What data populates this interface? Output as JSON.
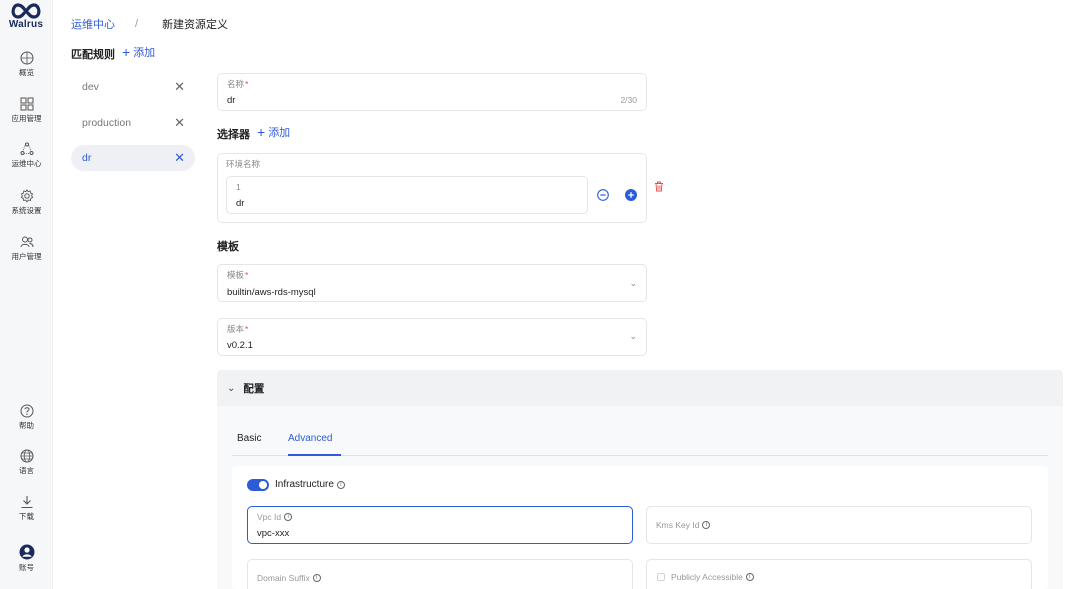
{
  "app": {
    "logo_text": "Walrus"
  },
  "sidebar": {
    "items": [
      {
        "label": "概览",
        "icon": "overview-icon"
      },
      {
        "label": "应用管理",
        "icon": "apps-grid-icon"
      },
      {
        "label": "运维中心",
        "icon": "ops-center-icon"
      },
      {
        "label": "系统设置",
        "icon": "gear-icon"
      },
      {
        "label": "用户管理",
        "icon": "users-icon"
      }
    ],
    "bottom_items": [
      {
        "label": "帮助",
        "icon": "help-icon"
      },
      {
        "label": "语言",
        "icon": "globe-icon"
      },
      {
        "label": "下载",
        "icon": "download-icon"
      },
      {
        "label": "账号",
        "icon": "account-icon"
      }
    ]
  },
  "breadcrumb": {
    "parent": "运维中心",
    "separator": "/",
    "current": "新建资源定义"
  },
  "rules": {
    "title": "匹配规则",
    "add_label": "添加",
    "items": [
      {
        "label": "dev",
        "active": false
      },
      {
        "label": "production",
        "active": false
      },
      {
        "label": "dr",
        "active": true
      }
    ]
  },
  "form": {
    "name": {
      "label": "名称",
      "value": "dr",
      "counter": "2/30"
    },
    "selector": {
      "title": "选择器",
      "add_label": "添加",
      "env_label": "环境名称",
      "row_index": "1",
      "row_value": "dr"
    },
    "template_section": {
      "title": "模板"
    },
    "template": {
      "label": "模板",
      "value": "builtin/aws-rds-mysql"
    },
    "version": {
      "label": "版本",
      "value": "v0.2.1"
    }
  },
  "config": {
    "title": "配置",
    "tabs": [
      {
        "label": "Basic",
        "active": false
      },
      {
        "label": "Advanced",
        "active": true
      }
    ],
    "infrastructure": {
      "label": "Infrastructure",
      "enabled": true
    },
    "vpc_id": {
      "label": "Vpc Id",
      "value": "vpc-xxx"
    },
    "kms_key_id": {
      "label": "Kms Key Id"
    },
    "domain_suffix": {
      "label": "Domain Suffix"
    },
    "publicly_accessible": {
      "label": "Publicly Accessible",
      "checked": false
    }
  },
  "colors": {
    "accent": "#2e5bd9",
    "danger": "#e24b4b"
  }
}
